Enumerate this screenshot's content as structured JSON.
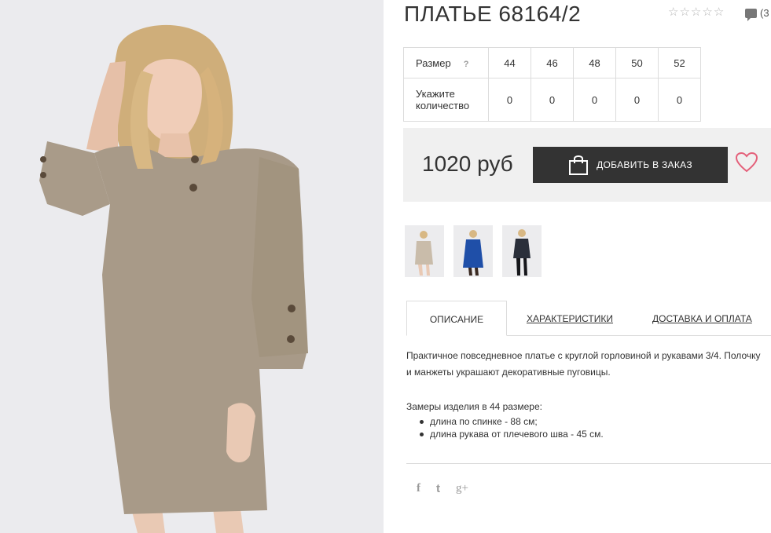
{
  "product": {
    "title": "ПЛАТЬЕ 68164/2",
    "comments_count": "(3"
  },
  "rating": {
    "value": 0,
    "max": 5,
    "star_glyph": "☆"
  },
  "sizes_table": {
    "size_label": "Размер",
    "help_icon": "?",
    "quantity_label": "Укажите количество",
    "sizes": [
      "44",
      "46",
      "48",
      "50",
      "52"
    ],
    "quantities": [
      "0",
      "0",
      "0",
      "0",
      "0"
    ]
  },
  "purchase": {
    "price": "1020 руб",
    "add_button_label": "ДОБАВИТЬ В ЗАКАЗ",
    "button_icon": "shopping-bag-icon",
    "wishlist_icon": "heart-icon"
  },
  "colors": {
    "accent_pink": "#e4607a",
    "button_bg": "#333333",
    "thumb_blue": "#1f4fa8",
    "thumb_dark": "#2a2f3a",
    "dress_beige": "#a89a88"
  },
  "thumbnails": [
    {
      "name": "beige-dress-thumb"
    },
    {
      "name": "blue-dress-thumb"
    },
    {
      "name": "dark-dress-thumb"
    }
  ],
  "tabs": [
    {
      "label": "ОПИСАНИЕ",
      "active": true
    },
    {
      "label": "ХАРАКТЕРИСТИКИ",
      "active": false
    },
    {
      "label": "ДОСТАВКА И ОПЛАТА",
      "active": false
    }
  ],
  "description": {
    "paragraph": "Практичное повседневное платье с круглой горловиной и рукавами 3/4. Полочку и манжеты украшают декоративные пуговицы.",
    "measurements_title": "Замеры изделия в 44 размере:",
    "measurements": [
      "длина по спинке - 88 см;",
      "длина рукава от плечевого шва - 45 см."
    ]
  },
  "social": {
    "facebook": "f",
    "twitter": "t",
    "googleplus": "g+"
  }
}
